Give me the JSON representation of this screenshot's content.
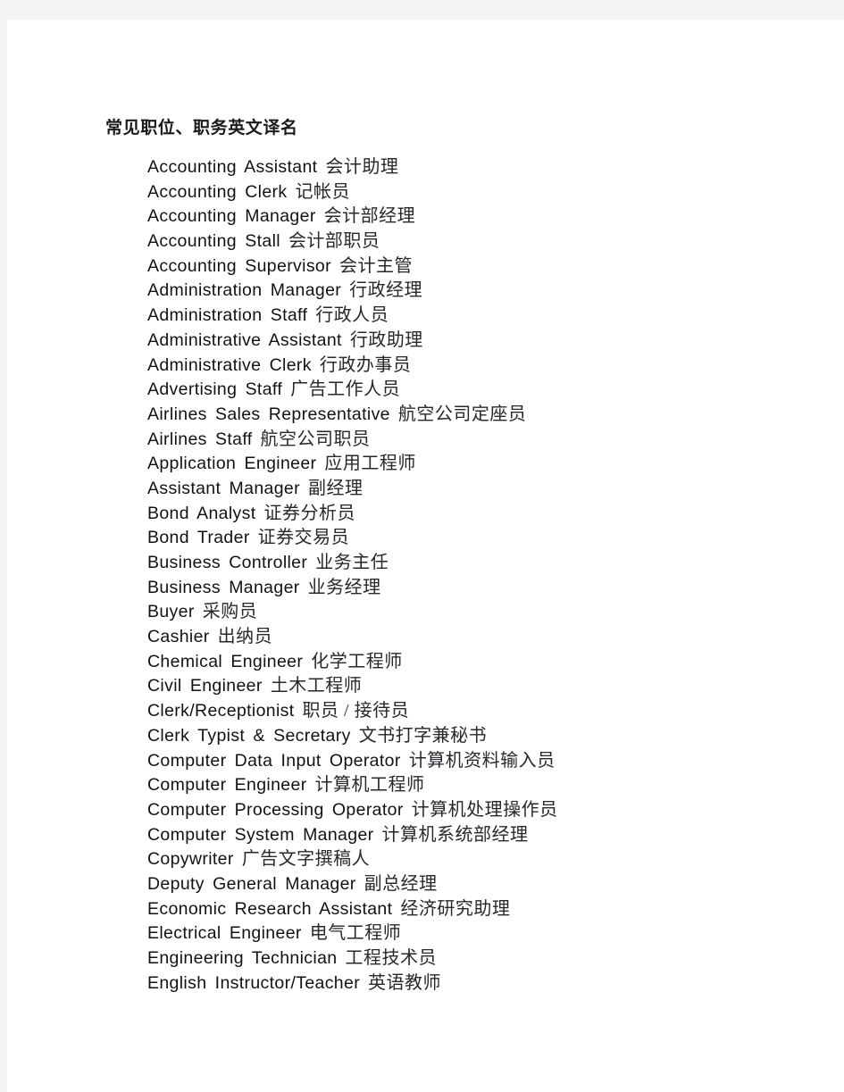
{
  "document": {
    "title": "常见职位、职务英文译名",
    "page_background": "#ffffff",
    "canvas_background": "#f4f4f4",
    "text_color": "#121212"
  },
  "entries": [
    {
      "en": "Accounting Assistant",
      "zh": "会计助理"
    },
    {
      "en": "Accounting Clerk",
      "zh": "记帐员"
    },
    {
      "en": "Accounting Manager",
      "zh": "会计部经理"
    },
    {
      "en": "Accounting Stall",
      "zh": "会计部职员"
    },
    {
      "en": "Accounting Supervisor",
      "zh": "会计主管"
    },
    {
      "en": "Administration Manager",
      "zh": "行政经理"
    },
    {
      "en": "Administration Staff",
      "zh": "行政人员"
    },
    {
      "en": "Administrative Assistant",
      "zh": "行政助理"
    },
    {
      "en": "Administrative Clerk",
      "zh": "行政办事员"
    },
    {
      "en": "Advertising Staff",
      "zh": "广告工作人员"
    },
    {
      "en": "Airlines Sales Representative",
      "zh": "航空公司定座员"
    },
    {
      "en": "Airlines Staff",
      "zh": "航空公司职员"
    },
    {
      "en": "Application Engineer",
      "zh": "应用工程师"
    },
    {
      "en": "Assistant Manager",
      "zh": "副经理"
    },
    {
      "en": "Bond Analyst",
      "zh": "证券分析员"
    },
    {
      "en": "Bond Trader",
      "zh": "证券交易员"
    },
    {
      "en": "Business Controller",
      "zh": "业务主任"
    },
    {
      "en": "Business Manager",
      "zh": "业务经理"
    },
    {
      "en": "Buyer",
      "zh": "采购员"
    },
    {
      "en": "Cashier",
      "zh": "出纳员"
    },
    {
      "en": "Chemical Engineer",
      "zh": "化学工程师"
    },
    {
      "en": "Civil Engineer",
      "zh": "土木工程师"
    },
    {
      "en": "Clerk/Receptionist",
      "zh": "职员 / 接待员"
    },
    {
      "en": "Clerk Typist & Secretary",
      "zh": "文书打字兼秘书"
    },
    {
      "en": "Computer Data Input Operator",
      "zh": "计算机资料输入员"
    },
    {
      "en": "Computer Engineer",
      "zh": "计算机工程师"
    },
    {
      "en": "Computer Processing Operator",
      "zh": "计算机处理操作员"
    },
    {
      "en": "Computer System Manager",
      "zh": "计算机系统部经理"
    },
    {
      "en": "Copywriter",
      "zh": "广告文字撰稿人"
    },
    {
      "en": "Deputy General Manager",
      "zh": "副总经理"
    },
    {
      "en": "Economic Research Assistant",
      "zh": "经济研究助理"
    },
    {
      "en": "Electrical Engineer",
      "zh": "电气工程师"
    },
    {
      "en": "Engineering Technician",
      "zh": "工程技术员"
    },
    {
      "en": "English Instructor/Teacher",
      "zh": "英语教师"
    }
  ]
}
